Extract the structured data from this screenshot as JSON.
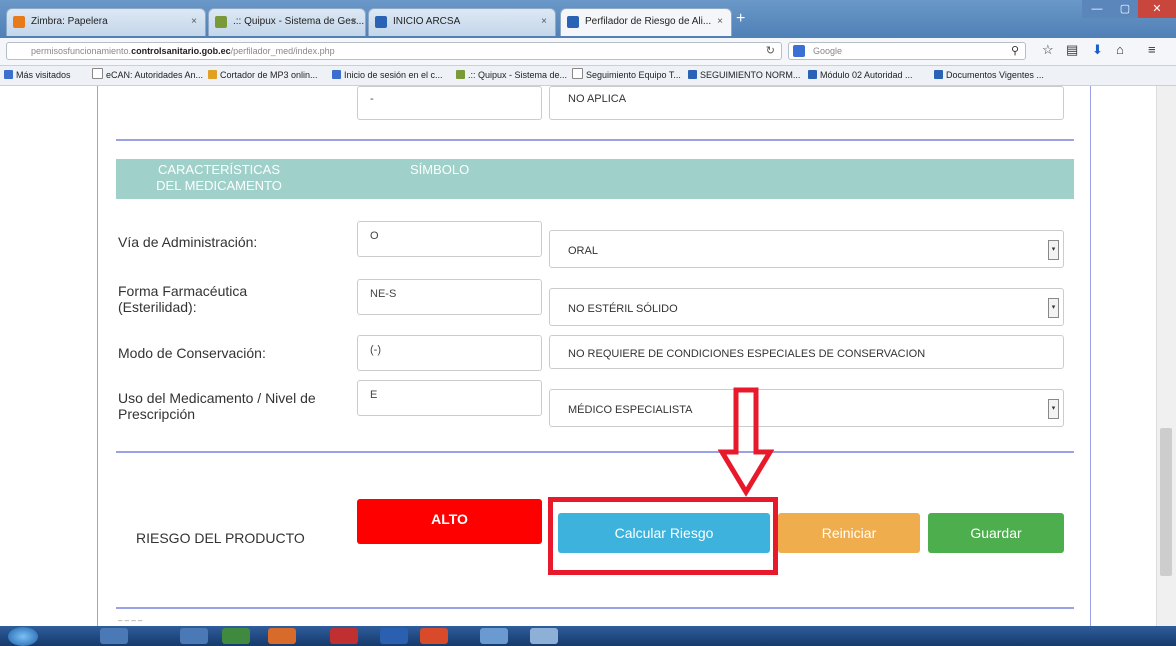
{
  "browser": {
    "tabs": [
      {
        "label": "Zimbra: Papelera",
        "icon_color": "#e87a1b"
      },
      {
        "label": ".:: Quipux - Sistema de Ges...",
        "icon_color": "#7a9a3a"
      },
      {
        "label": "INICIO ARCSA",
        "icon_color": "#2a62b5"
      },
      {
        "label": "Perfilador de Riesgo de Ali...",
        "icon_color": "#2a62b5"
      }
    ],
    "close_glyph": "×",
    "new_tab_glyph": "+",
    "url_prefix": "permisosfuncionamiento.",
    "url_domain": "controlsanitario.gob.ec",
    "url_path": "/perfilador_med/index.php",
    "search_engine": "Google",
    "bookmarks": [
      "Más visitados",
      "eCAN: Autoridades An...",
      "Cortador de MP3 onlin...",
      "Inicio de sesión en el c...",
      ".:: Quipux - Sistema de...",
      "Seguimiento Equipo T...",
      "SEGUIMIENTO NORM...",
      "Módulo 02 Autoridad ...",
      "Documentos Vigentes ..."
    ]
  },
  "form": {
    "top_row": {
      "code": "-",
      "value": "NO APLICA"
    },
    "section_header": {
      "col1": "CARACTERÍSTICAS DEL MEDICAMENTO",
      "col2": "SÍMBOLO"
    },
    "fields": [
      {
        "label": "Vía de Administración:",
        "code": "O",
        "value": "ORAL",
        "has_dropdown": true
      },
      {
        "label": "Forma Farmacéutica (Esterilidad):",
        "code": "NE-S",
        "value": "NO ESTÉRIL SÓLIDO",
        "has_dropdown": true
      },
      {
        "label": "Modo de Conservación:",
        "code": "(-)",
        "value": "NO REQUIERE DE CONDICIONES ESPECIALES DE CONSERVACION",
        "has_dropdown": false
      },
      {
        "label": "Uso del Medicamento / Nivel de Prescripción",
        "code": "E",
        "value": "MÉDICO ESPECIALISTA",
        "has_dropdown": true
      }
    ],
    "risk": {
      "label": "RIESGO DEL PRODUCTO",
      "level": "ALTO",
      "level_color": "#ff0000",
      "calc_button": "Calcular Riesgo",
      "calc_color": "#3db2dd",
      "reset_button": "Reiniciar",
      "reset_color": "#f0ad4e",
      "save_button": "Guardar",
      "save_color": "#4cae4c"
    },
    "annotation_color": "#e8192b",
    "bottom_fragment": "– – – –"
  },
  "icons": {
    "dropdown_arrow": "▾"
  }
}
